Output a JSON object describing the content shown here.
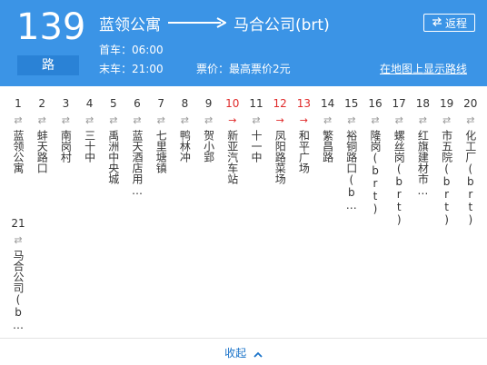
{
  "header": {
    "route_number": "139",
    "route_suffix": "路",
    "origin": "蓝领公寓",
    "destination": "马合公司(brt)",
    "first_bus": "首车：06:00",
    "last_bus": "末车：21:00",
    "fare": "票价：最高票价2元",
    "reverse_button": "返程",
    "map_link": "在地图上显示路线",
    "bg_color": "#3b94e6",
    "suffix_bg_color": "#2a82d6"
  },
  "stops": [
    {
      "num": "1",
      "name": "蓝领公寓",
      "highlight": false
    },
    {
      "num": "2",
      "name": "蚌天路口",
      "highlight": false
    },
    {
      "num": "3",
      "name": "南岗村",
      "highlight": false
    },
    {
      "num": "4",
      "name": "三十中",
      "highlight": false
    },
    {
      "num": "5",
      "name": "禹洲中央城",
      "highlight": false
    },
    {
      "num": "6",
      "name": "蓝天酒店用…",
      "highlight": false
    },
    {
      "num": "7",
      "name": "七里塘镇",
      "highlight": false
    },
    {
      "num": "8",
      "name": "鸭林冲",
      "highlight": false
    },
    {
      "num": "9",
      "name": "贺小郢",
      "highlight": false
    },
    {
      "num": "10",
      "name": "新亚汽车站",
      "highlight": true
    },
    {
      "num": "11",
      "name": "十一中",
      "highlight": false
    },
    {
      "num": "12",
      "name": "凤阳路菜场",
      "highlight": true
    },
    {
      "num": "13",
      "name": "和平广场",
      "highlight": true
    },
    {
      "num": "14",
      "name": "繁昌路",
      "highlight": false
    },
    {
      "num": "15",
      "name": "裕铜路口(b…",
      "highlight": false
    },
    {
      "num": "16",
      "name": "隆岗(brt)",
      "highlight": false
    },
    {
      "num": "17",
      "name": "螺丝岗(brt)",
      "highlight": false
    },
    {
      "num": "18",
      "name": "红旗建材市…",
      "highlight": false
    },
    {
      "num": "19",
      "name": "市五院(brt)",
      "highlight": false
    },
    {
      "num": "20",
      "name": "化工厂(brt)",
      "highlight": false
    },
    {
      "num": "21",
      "name": "马合公司(b…",
      "highlight": false
    }
  ],
  "footer": {
    "collapse_label": "收起",
    "link_color": "#1a73c9"
  },
  "icons": {
    "normal_stop": "bidirectional-arrows-icon",
    "highlight_stop": "red-arrow-icon",
    "collapse": "chevron-up-icon",
    "reverse": "swap-icon"
  },
  "colors": {
    "highlight": "#e02b2b"
  }
}
